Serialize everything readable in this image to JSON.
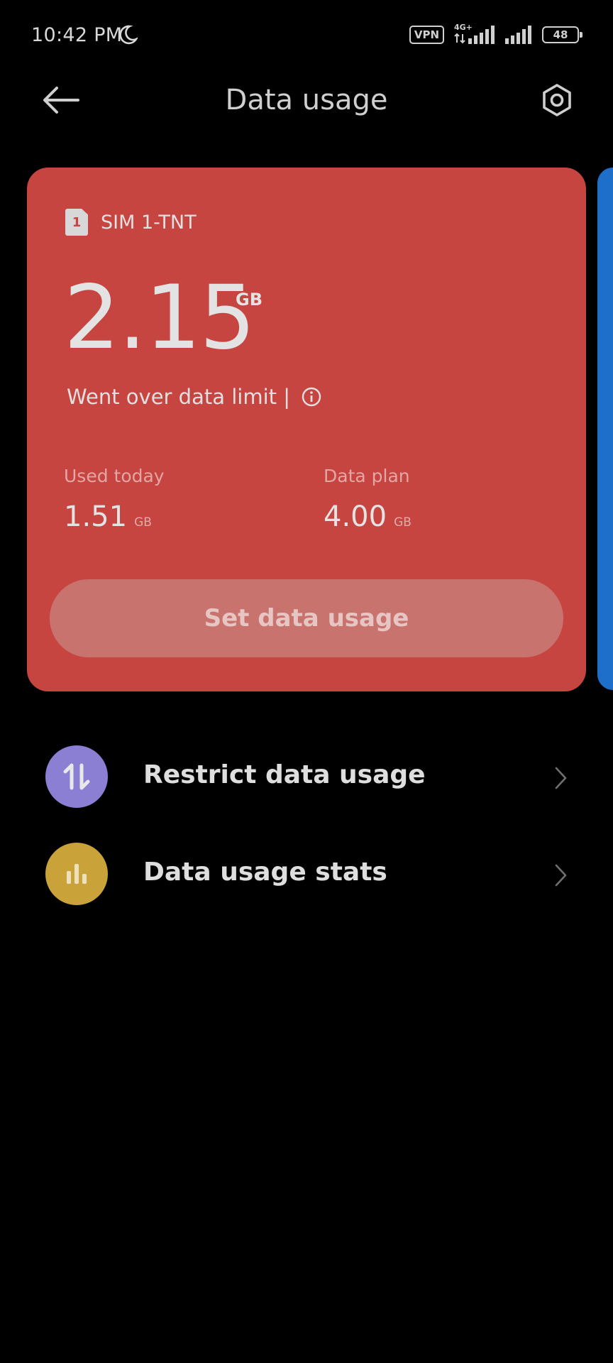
{
  "status_bar": {
    "time": "10:42 PM",
    "vpn": "VPN",
    "network_type": "4G+",
    "battery": "48"
  },
  "header": {
    "title": "Data usage"
  },
  "card": {
    "sim_number": "1",
    "sim_name": "SIM 1-TNT",
    "usage_value": "2.15",
    "usage_unit": "GB",
    "status_text": "Went over data limit |",
    "used_today_label": "Used today",
    "used_today_value": "1.51",
    "used_today_unit": "GB",
    "data_plan_label": "Data plan",
    "data_plan_value": "4.00",
    "data_plan_unit": "GB",
    "button_label": "Set data usage",
    "color": "#c74541"
  },
  "list": [
    {
      "label": "Restrict data usage",
      "icon": "up-down-arrows-icon",
      "color": "#8b7fd4"
    },
    {
      "label": "Data usage stats",
      "icon": "bar-chart-icon",
      "color": "#c9a33a"
    }
  ]
}
